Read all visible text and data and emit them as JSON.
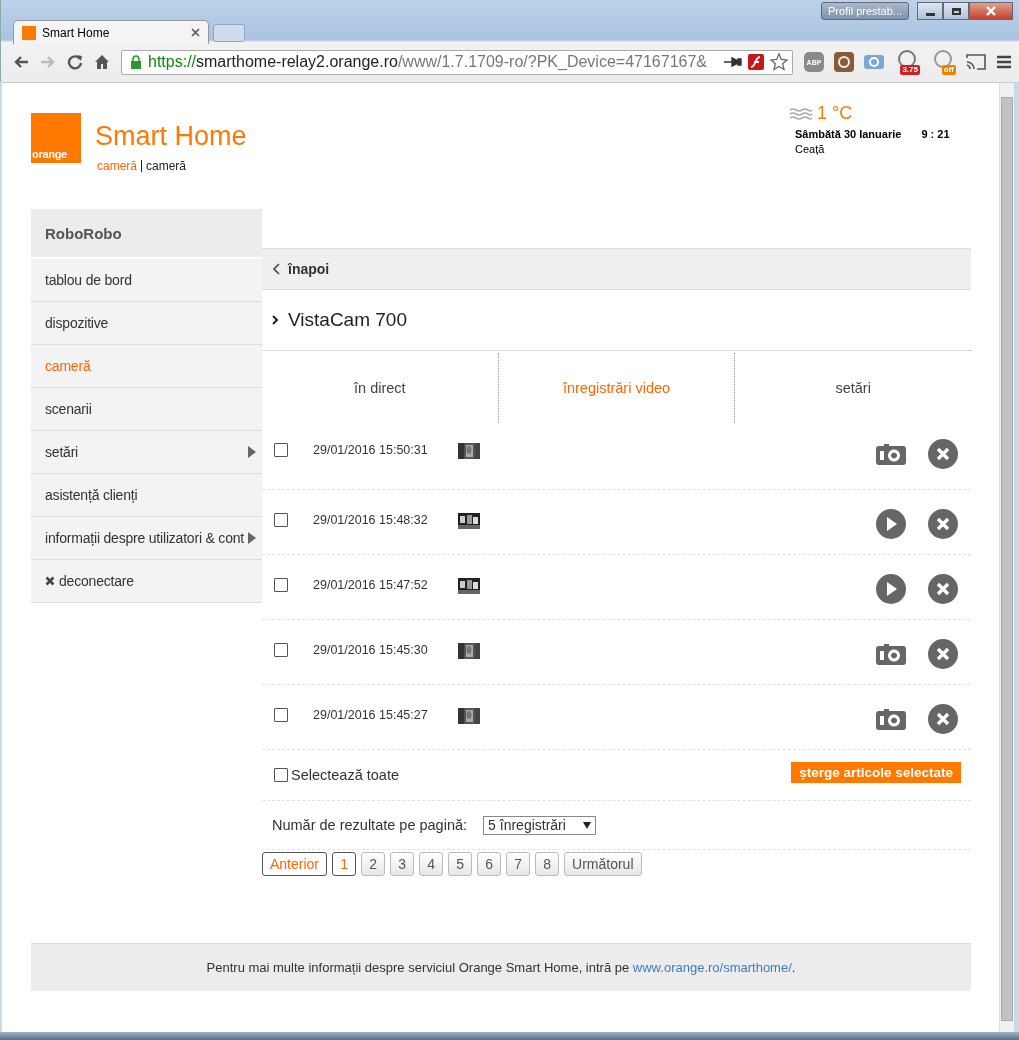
{
  "browser": {
    "tab_title": "Smart Home",
    "profile_button": "Profil prestab...",
    "url": {
      "scheme": "https://",
      "host": "smarthome-relay2.orange.ro",
      "path": "/www/1.7.1709-ro/?PK_Device=47167167&"
    },
    "extensions": [
      {
        "kind": "abp",
        "label": "ABP"
      },
      {
        "kind": "instagram"
      },
      {
        "kind": "camera"
      },
      {
        "kind": "speed",
        "label": "3.75"
      },
      {
        "kind": "off",
        "label": "off"
      },
      {
        "kind": "cast"
      }
    ]
  },
  "header": {
    "logo": "orange",
    "title": "Smart Home",
    "breadcrumb": [
      {
        "label": "cameră",
        "link": true
      },
      {
        "label": "cameră",
        "link": false
      }
    ]
  },
  "weather": {
    "temperature": "1 °C",
    "date": "Sâmbătă 30 Ianuarie",
    "time": "9 : 21",
    "condition": "Ceață"
  },
  "sidebar": {
    "title": "RoboRobo",
    "items": [
      {
        "label": "tablou de bord",
        "kind": "plain",
        "selected": false
      },
      {
        "label": "dispozitive",
        "kind": "plain",
        "selected": false
      },
      {
        "label": "cameră",
        "kind": "plain",
        "selected": true
      },
      {
        "label": "scenarii",
        "kind": "plain",
        "selected": false
      },
      {
        "label": "setări",
        "kind": "submenu",
        "selected": false
      },
      {
        "label": "asistență clienți",
        "kind": "plain",
        "selected": false
      },
      {
        "label": "informații despre utilizatori & cont",
        "kind": "submenu",
        "selected": false
      },
      {
        "label": "deconectare",
        "kind": "logout",
        "selected": false
      }
    ]
  },
  "back_link": "înapoi",
  "device_name": "VistaCam 700",
  "tabs": [
    {
      "label": "în direct",
      "selected": false
    },
    {
      "label": "înregistrări video",
      "selected": true
    },
    {
      "label": "setări",
      "selected": false
    }
  ],
  "recordings": [
    {
      "datetime": "29/01/2016 15:50:31",
      "checked": false
    },
    {
      "datetime": "29/01/2016 15:48:32",
      "kind": "video",
      "checked": false
    },
    {
      "datetime": "29/01/2016 15:47:52",
      "kind": "video",
      "checked": false
    },
    {
      "datetime": "29/01/2016 15:45:30",
      "checked": false
    },
    {
      "datetime": "29/01/2016 15:45:27",
      "checked": false
    }
  ],
  "select_all": {
    "label": "Selectează toate",
    "checked": false
  },
  "delete_selected": "șterge articole selectate",
  "per_page": {
    "label": "Număr de rezultate pe pagină:",
    "value": "5 înregistrări"
  },
  "pagination": {
    "previous": "Anterior",
    "next": "Următorul",
    "pages": [
      {
        "label": "1",
        "selected": true
      },
      {
        "label": "2",
        "selected": false
      },
      {
        "label": "3",
        "selected": false
      },
      {
        "label": "4",
        "selected": false
      },
      {
        "label": "5",
        "selected": false
      },
      {
        "label": "6",
        "selected": false
      },
      {
        "label": "7",
        "selected": false
      },
      {
        "label": "8",
        "selected": false
      }
    ]
  },
  "footer": {
    "text": "Pentru mai multe informații despre serviciul Orange Smart Home, intră pe ",
    "link": "www.orange.ro/smarthome/",
    "after": "."
  }
}
